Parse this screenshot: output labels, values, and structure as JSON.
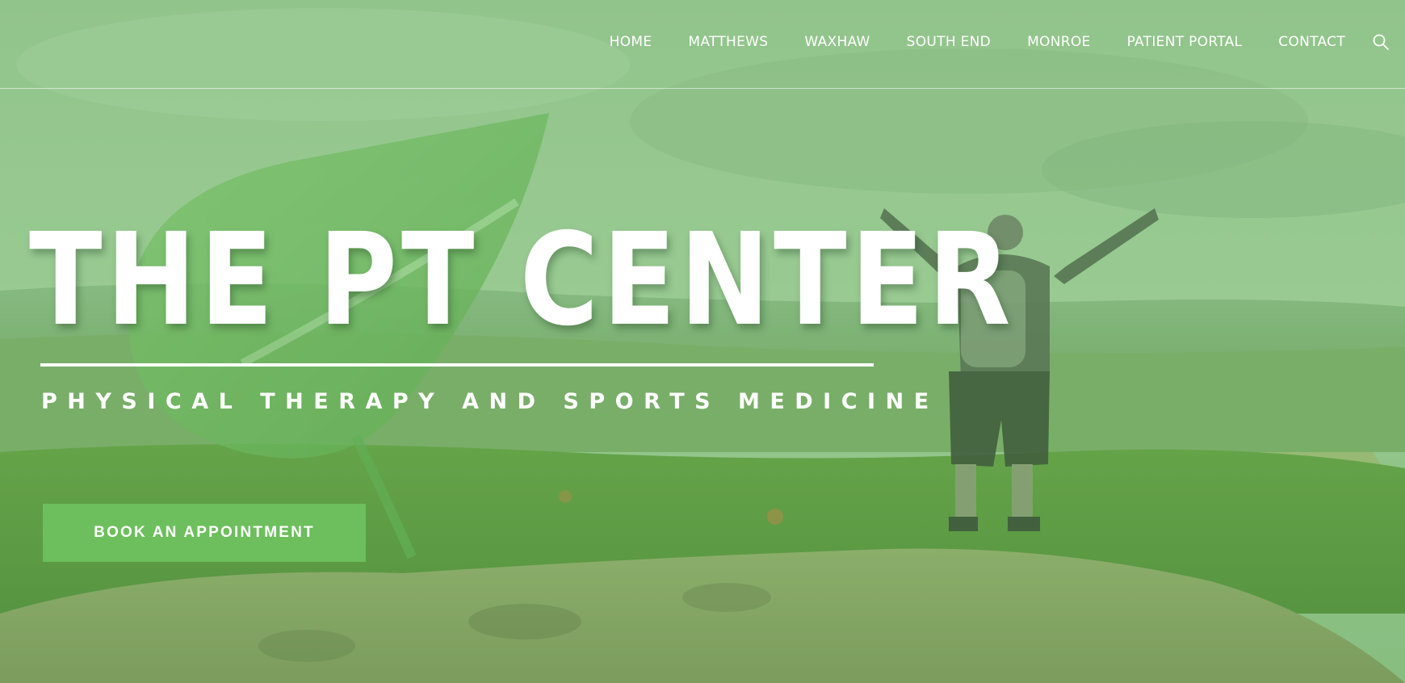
{
  "nav": {
    "items": [
      {
        "label": "HOME"
      },
      {
        "label": "MATTHEWS"
      },
      {
        "label": "WAXHAW"
      },
      {
        "label": "SOUTH END"
      },
      {
        "label": "MONROE"
      },
      {
        "label": "PATIENT PORTAL"
      },
      {
        "label": "CONTACT"
      }
    ],
    "search_icon": "search-icon"
  },
  "hero": {
    "title": "THE PT CENTER",
    "subtitle": "PHYSICAL THERAPY AND SPORTS MEDICINE",
    "cta_label": "BOOK AN APPOINTMENT",
    "logo_icon": "leaf-logo-icon"
  },
  "colors": {
    "accent": "#6cbf5c",
    "overlay": "#78be6e",
    "text": "#ffffff"
  }
}
